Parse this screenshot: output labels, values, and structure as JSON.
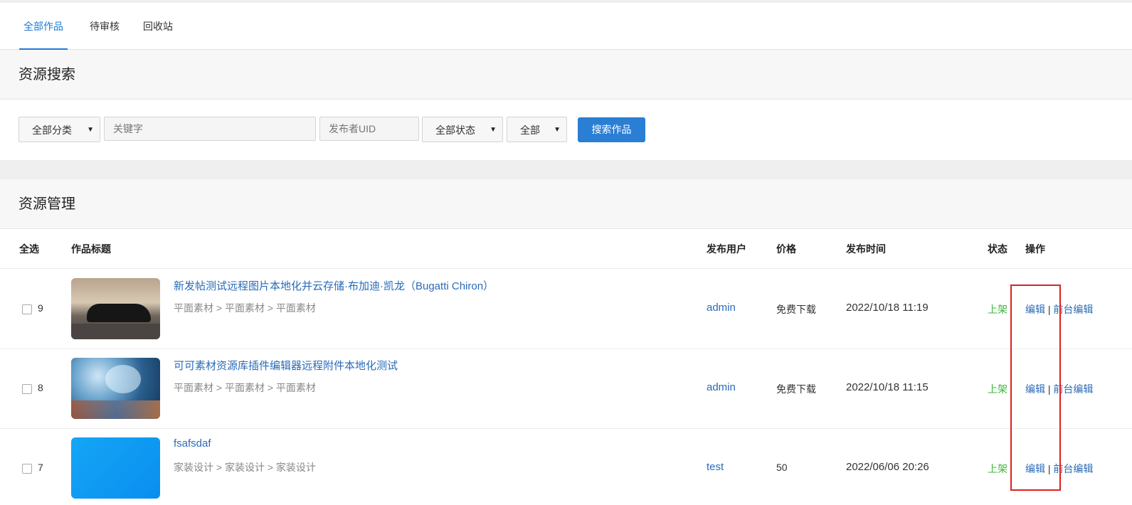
{
  "tabs": [
    {
      "label": "全部作品",
      "active": true
    },
    {
      "label": "待审核",
      "active": false
    },
    {
      "label": "回收站",
      "active": false
    }
  ],
  "search": {
    "heading": "资源搜索",
    "category_select": "全部分类",
    "keyword_placeholder": "关键字",
    "uid_placeholder": "发布者UID",
    "status_select": "全部状态",
    "all_select": "全部",
    "button_label": "搜索作品"
  },
  "manage": {
    "heading": "资源管理",
    "columns": {
      "select_all": "全选",
      "title": "作品标题",
      "user": "发布用户",
      "price": "价格",
      "time": "发布时间",
      "status": "状态",
      "ops": "操作"
    },
    "rows": [
      {
        "id": "9",
        "title": "新发帖测试远程图片本地化并云存储·布加迪·凯龙（Bugatti Chiron）",
        "category": "平面素材 > 平面素材 > 平面素材",
        "user": "admin",
        "price": "免费下载",
        "time": "2022/10/18 11:19",
        "status": "上架",
        "edit": "编辑",
        "sep": "|",
        "front_edit": "前台编辑"
      },
      {
        "id": "8",
        "title": "可可素材资源库插件编辑器远程附件本地化测试",
        "category": "平面素材 > 平面素材 > 平面素材",
        "user": "admin",
        "price": "免费下载",
        "time": "2022/10/18 11:15",
        "status": "上架",
        "edit": "编辑",
        "sep": "|",
        "front_edit": "前台编辑"
      },
      {
        "id": "7",
        "title": "fsafsdaf",
        "category": "家装设计 > 家装设计 > 家装设计",
        "user": "test",
        "price": "50",
        "time": "2022/06/06 20:26",
        "status": "上架",
        "edit": "编辑",
        "sep": "|",
        "front_edit": "前台编辑"
      }
    ]
  },
  "colors": {
    "accent": "#1e7bd4",
    "link": "#2a6bb8",
    "status_green": "#3cb43c",
    "highlight_red": "#e02020"
  }
}
